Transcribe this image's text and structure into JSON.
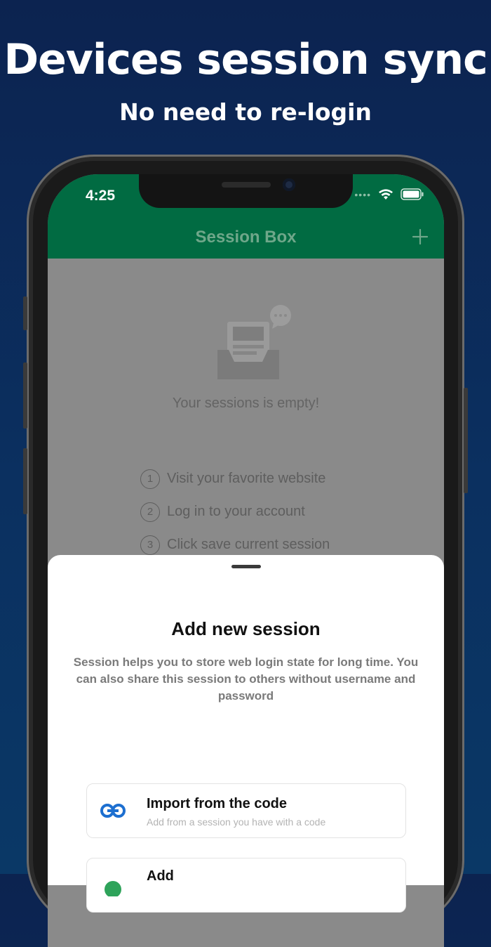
{
  "promo": {
    "title": "Devices session sync",
    "subtitle": "No need to re-login"
  },
  "status_bar": {
    "time": "4:25",
    "icons": [
      "cellular-dots-icon",
      "wifi-icon",
      "battery-icon"
    ]
  },
  "nav": {
    "title": "Session Box",
    "add_icon": "plus-icon"
  },
  "empty_state": {
    "icon": "empty-inbox-icon",
    "message": "Your sessions is empty!",
    "steps": [
      {
        "num": "1",
        "text": "Visit your favorite website"
      },
      {
        "num": "2",
        "text": "Log in to your account"
      },
      {
        "num": "3",
        "text": "Click save current session"
      }
    ]
  },
  "sheet": {
    "title": "Add new session",
    "description": "Session helps you to store web login state for long time. You can also share this session to others without username and password",
    "options": [
      {
        "icon": "link-icon",
        "title": "Import from the code",
        "subtitle": "Add from a session you have with a code"
      },
      {
        "icon": "add-icon",
        "title": "Add",
        "subtitle": ""
      }
    ]
  },
  "colors": {
    "background": "#0c2350",
    "app_bar": "#016b42",
    "overlay": "#8a8a8a",
    "link_icon": "#1d6fd0",
    "add_icon": "#2ea35a"
  }
}
